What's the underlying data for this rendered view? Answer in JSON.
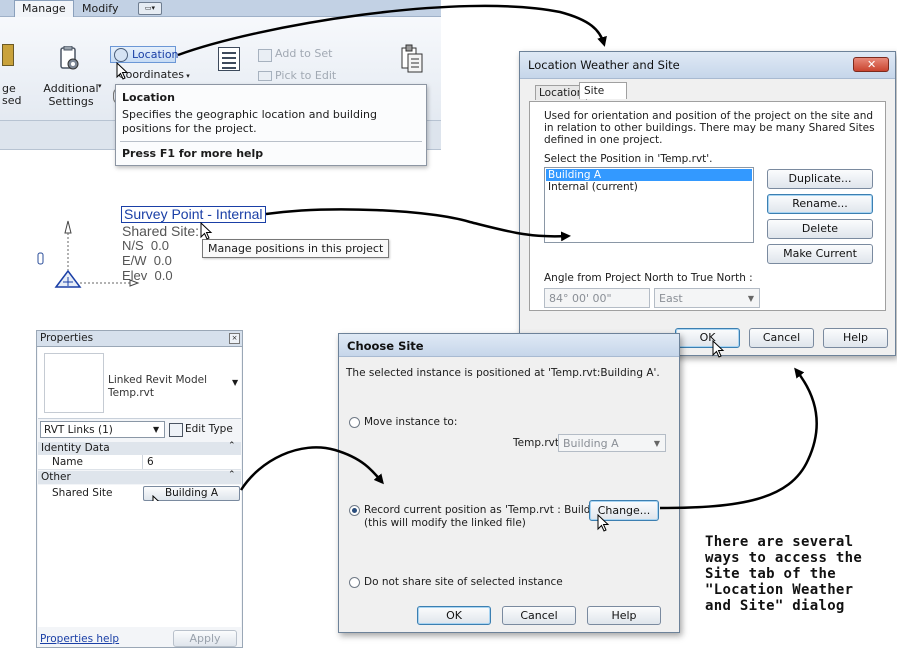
{
  "ribbon": {
    "tabs": [
      "Manage",
      "Modify"
    ],
    "location_label": "Location",
    "coordinates_label": "Coordinates",
    "add_to_set_label": "Add to Set",
    "pick_to_edit_label": "Pick to Edit",
    "additional_settings_label": "Additional Settings",
    "left_cut_labels": [
      "ge",
      "sed"
    ]
  },
  "tooltip": {
    "title": "Location",
    "description": "Specifies the geographic location and building positions for the project.",
    "help": "Press F1 for more help"
  },
  "survey": {
    "title": "Survey Point - Internal",
    "shared_site": "Shared Site:",
    "ns": "N/S  0.0",
    "ew": "E/W  0.0",
    "elev": "Elev  0.0",
    "tooltip": "Manage positions in this project"
  },
  "lws_dialog": {
    "title": "Location Weather and Site",
    "tabs": [
      "Location",
      "Site"
    ],
    "description": "Used for orientation and position of the project on the site and in relation to other buildings. There may be many Shared Sites defined in one project.",
    "select_label": "Select the Position in 'Temp.rvt'.",
    "positions": [
      "Building A",
      "Internal (current)"
    ],
    "buttons": {
      "duplicate": "Duplicate...",
      "rename": "Rename...",
      "delete": "Delete",
      "make_current": "Make Current",
      "ok": "OK",
      "cancel": "Cancel",
      "help": "Help"
    },
    "angle_label": "Angle from Project North to True North :",
    "angle_value": "84° 00' 00\"",
    "direction_value": "East"
  },
  "properties": {
    "title": "Properties",
    "type_name": "Linked Revit Model",
    "type_file": "Temp.rvt",
    "selector": "RVT Links (1)",
    "edit_type": "Edit Type",
    "groups": [
      "Identity Data",
      "Other"
    ],
    "name_label": "Name",
    "name_value": "6",
    "shared_site_label": "Shared Site",
    "shared_site_value": "Building A",
    "help_link": "Properties help",
    "apply": "Apply"
  },
  "choose_site": {
    "title": "Choose Site",
    "intro": "The selected instance is positioned at 'Temp.rvt:Building A'.",
    "option_move": "Move instance to:",
    "move_file_label": "Temp.rvt:",
    "move_value": "Building A",
    "option_record": "Record current position as 'Temp.rvt : Building A'",
    "option_record_note": "(this will modify the linked file)",
    "change_button": "Change...",
    "option_noshare": "Do not share site of selected instance",
    "buttons": {
      "ok": "OK",
      "cancel": "Cancel",
      "help": "Help"
    }
  },
  "annotation": {
    "lines": [
      "There are several",
      "ways to access the",
      "Site tab of the",
      "\"Location Weather",
      "and Site\" dialog"
    ]
  },
  "colors": {
    "accent_blue": "#1a3fa6",
    "selection": "#3399ff",
    "title_gradient_top": "#dfe9f5",
    "close_red": "#c9442f"
  }
}
